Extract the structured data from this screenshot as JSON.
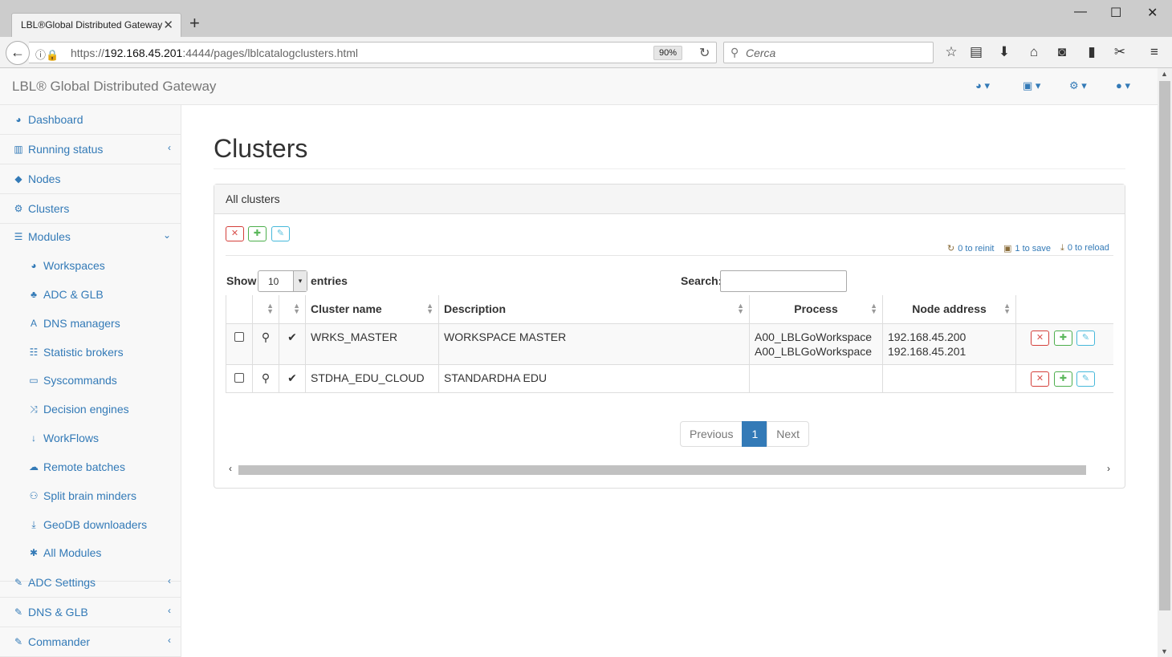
{
  "browser": {
    "tab_title": "LBL®Global Distributed Gateway",
    "url_prefix": "https://",
    "url_host": "192.168.45.201",
    "url_rest": ":4444/pages/lblcatalogclusters.html",
    "zoom": "90%",
    "search_placeholder": "Cerca"
  },
  "app": {
    "brand": "LBL® Global Distributed Gateway"
  },
  "sidebar": {
    "items": [
      {
        "label": "Dashboard",
        "icon": "dashboard-icon"
      },
      {
        "label": "Running status",
        "icon": "bar-chart-icon"
      },
      {
        "label": "Nodes",
        "icon": "cube-icon"
      },
      {
        "label": "Clusters",
        "icon": "cogs-icon"
      },
      {
        "label": "Modules",
        "icon": "list-icon"
      }
    ],
    "modules": [
      {
        "label": "Workspaces",
        "icon": "dashboard-icon"
      },
      {
        "label": "ADC & GLB",
        "icon": "sitemap-icon"
      },
      {
        "label": "DNS managers",
        "icon": "font-icon"
      },
      {
        "label": "Statistic brokers",
        "icon": "database-icon"
      },
      {
        "label": "Syscommands",
        "icon": "laptop-icon"
      },
      {
        "label": "Decision engines",
        "icon": "random-icon"
      },
      {
        "label": "WorkFlows",
        "icon": "sort-numeric-icon"
      },
      {
        "label": "Remote batches",
        "icon": "cloud-upload-icon"
      },
      {
        "label": "Split brain minders",
        "icon": "users-icon"
      },
      {
        "label": "GeoDB downloaders",
        "icon": "download-icon"
      },
      {
        "label": "All Modules",
        "icon": "asterisk-icon"
      }
    ],
    "bottom": [
      {
        "label": "ADC Settings",
        "icon": "edit-icon"
      },
      {
        "label": "DNS & GLB",
        "icon": "edit-icon"
      },
      {
        "label": "Commander",
        "icon": "edit-icon"
      }
    ]
  },
  "main": {
    "title": "Clusters",
    "panel_title": "All clusters",
    "pending": {
      "reinit": "0 to reinit",
      "save": "1 to save",
      "reload": "0 to reload"
    },
    "show_label": "Show",
    "page_length": "10",
    "entries_label": "entries",
    "search_label": "Search:",
    "search_value": "",
    "columns": [
      "Cluster name",
      "Description",
      "Process",
      "Node address"
    ],
    "rows": [
      {
        "name": "WRKS_MASTER",
        "description": "WORKSPACE MASTER",
        "process_1": "A00_LBLGoWorkspace",
        "process_2": "A00_LBLGoWorkspace",
        "node_1": "192.168.45.200",
        "node_2": "192.168.45.201"
      },
      {
        "name": "STDHA_EDU_CLOUD",
        "description": "STANDARDHA EDU",
        "process_1": "",
        "process_2": "",
        "node_1": "",
        "node_2": ""
      }
    ],
    "pagination": {
      "previous": "Previous",
      "current": "1",
      "next": "Next"
    }
  },
  "colors": {
    "link": "#337ab7",
    "danger": "#d9534f",
    "success": "#5cb85c",
    "info": "#5bc0de",
    "active_page": "#337ab7"
  }
}
